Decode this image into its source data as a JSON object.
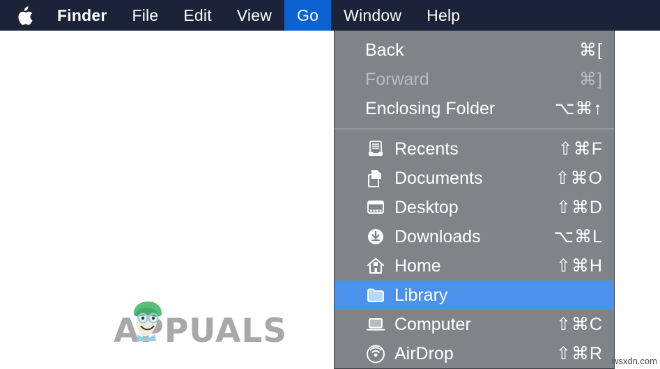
{
  "menubar": {
    "apple_icon": "apple-logo-icon",
    "items": [
      {
        "label": "Finder",
        "name": "menubar-item-finder",
        "bold": true,
        "active": false
      },
      {
        "label": "File",
        "name": "menubar-item-file",
        "bold": false,
        "active": false
      },
      {
        "label": "Edit",
        "name": "menubar-item-edit",
        "bold": false,
        "active": false
      },
      {
        "label": "View",
        "name": "menubar-item-view",
        "bold": false,
        "active": false
      },
      {
        "label": "Go",
        "name": "menubar-item-go",
        "bold": false,
        "active": true
      },
      {
        "label": "Window",
        "name": "menubar-item-window",
        "bold": false,
        "active": false
      },
      {
        "label": "Help",
        "name": "menubar-item-help",
        "bold": false,
        "active": false
      }
    ],
    "background_color": "#1c2338",
    "active_color": "#0a62d0",
    "text_color": "#ffffff"
  },
  "go_menu": {
    "background_color": "#808488",
    "selected_color": "#4b92ec",
    "disabled_color": "#b9bcbf",
    "groups": [
      {
        "items": [
          {
            "label": "Back",
            "shortcut": "⌘[",
            "icon": "",
            "disabled": false,
            "selected": false
          },
          {
            "label": "Forward",
            "shortcut": "⌘]",
            "icon": "",
            "disabled": true,
            "selected": false
          },
          {
            "label": "Enclosing Folder",
            "shortcut": "⌥⌘↑",
            "icon": "",
            "disabled": false,
            "selected": false
          }
        ]
      },
      {
        "items": [
          {
            "label": "Recents",
            "shortcut": "⇧⌘F",
            "icon": "recents-tray-icon",
            "disabled": false,
            "selected": false
          },
          {
            "label": "Documents",
            "shortcut": "⇧⌘O",
            "icon": "documents-icon",
            "disabled": false,
            "selected": false
          },
          {
            "label": "Desktop",
            "shortcut": "⇧⌘D",
            "icon": "desktop-icon",
            "disabled": false,
            "selected": false
          },
          {
            "label": "Downloads",
            "shortcut": "⌥⌘L",
            "icon": "downloads-icon",
            "disabled": false,
            "selected": false
          },
          {
            "label": "Home",
            "shortcut": "⇧⌘H",
            "icon": "home-house-icon",
            "disabled": false,
            "selected": false
          },
          {
            "label": "Library",
            "shortcut": "",
            "icon": "folder-icon",
            "disabled": false,
            "selected": true
          },
          {
            "label": "Computer",
            "shortcut": "⇧⌘C",
            "icon": "computer-laptop-icon",
            "disabled": false,
            "selected": false
          },
          {
            "label": "AirDrop",
            "shortcut": "⇧⌘R",
            "icon": "airdrop-radar-icon",
            "disabled": false,
            "selected": false
          }
        ]
      }
    ]
  },
  "watermarks": {
    "appuals": "APPUALS",
    "appuals_color": "#a8a8a8",
    "site": "wsxdn.com"
  }
}
